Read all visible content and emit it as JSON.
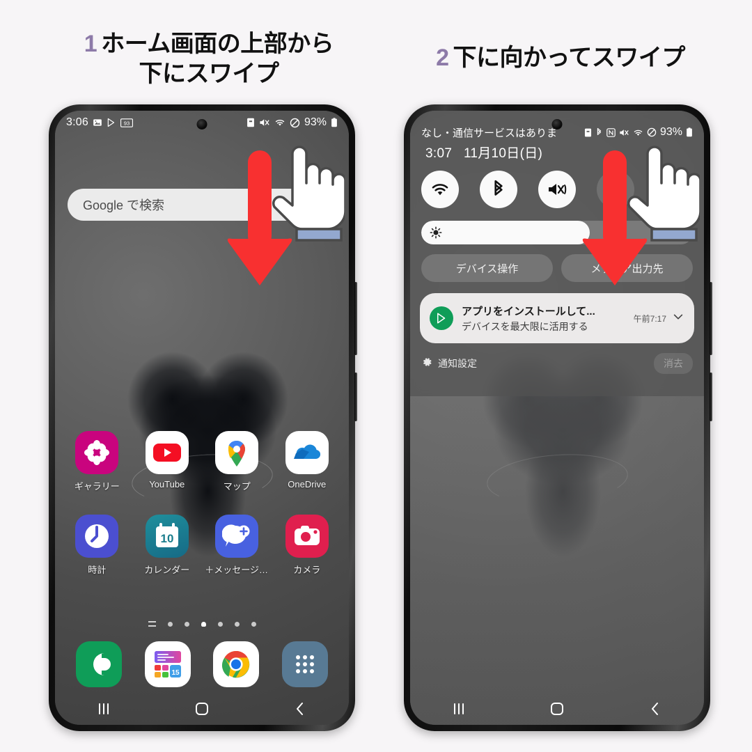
{
  "background_color": "#f7f5f7",
  "accent_number_color": "#8d7aa8",
  "arrow_color": "#f83030",
  "steps": [
    {
      "number": "1",
      "text_line1": "ホーム画面の上部から",
      "text_line2": "下にスワイプ"
    },
    {
      "number": "2",
      "text_line1": "下に向かってスワイプ",
      "text_line2": ""
    }
  ],
  "phone1": {
    "statusbar": {
      "time": "3:06",
      "icons_left": [
        "image-icon",
        "play-store-icon",
        "badge-93-icon"
      ],
      "badge_text": "93",
      "icons_right": [
        "sim-icon",
        "mute-icon",
        "wifi-icon",
        "dnd-icon"
      ],
      "battery_percent": "93%"
    },
    "search": {
      "placeholder": "Google で検索"
    },
    "apps_row1": [
      {
        "label": "ギャラリー",
        "icon": "gallery-icon"
      },
      {
        "label": "YouTube",
        "icon": "youtube-icon"
      },
      {
        "label": "マップ",
        "icon": "google-maps-icon"
      },
      {
        "label": "OneDrive",
        "icon": "onedrive-icon"
      }
    ],
    "apps_row2": [
      {
        "label": "時計",
        "icon": "clock-icon"
      },
      {
        "label": "カレンダー",
        "icon": "calendar-icon",
        "day": "10"
      },
      {
        "label": "＋メッセージ(...",
        "icon": "plus-message-icon"
      },
      {
        "label": "カメラ",
        "icon": "camera-icon"
      }
    ],
    "page_dots": {
      "count": 6,
      "active_index": 3,
      "has_leading_lines": true
    },
    "dock": [
      {
        "label": "",
        "icon": "phone-icon"
      },
      {
        "label": "",
        "icon": "widget-folder-icon",
        "day": "15"
      },
      {
        "label": "",
        "icon": "chrome-icon"
      },
      {
        "label": "",
        "icon": "app-drawer-icon"
      }
    ],
    "navbar": [
      "recents-icon",
      "home-icon",
      "back-icon"
    ]
  },
  "phone2": {
    "statusbar": {
      "carrier_text": "なし・通信サービスはありま",
      "icons_right": [
        "sim-icon",
        "bluetooth-icon",
        "nfc-icon",
        "mute-icon",
        "wifi-icon",
        "dnd-icon"
      ],
      "battery_percent": "93%"
    },
    "shade": {
      "time": "3:07",
      "date": "11月10日(日)",
      "quick_toggles": [
        {
          "icon": "wifi-icon",
          "state": "on"
        },
        {
          "icon": "bluetooth-icon",
          "state": "on"
        },
        {
          "icon": "sound-mute-vibrate-icon",
          "state": "on"
        },
        {
          "icon": "rotation-lock-icon",
          "state": "off"
        },
        {
          "icon": "flashlight-icon",
          "state": "off"
        }
      ],
      "brightness": {
        "icon": "brightness-icon",
        "level_percent": 62
      },
      "buttons": [
        {
          "label": "デバイス操作"
        },
        {
          "label": "メディア出力先"
        }
      ],
      "notification": {
        "app_icon": "play-store-icon",
        "title": "アプリをインストールして...",
        "text": "デバイスを最大限に活用する",
        "time": "午前7:17",
        "expand_icon": "chevron-down-icon"
      },
      "footer": {
        "settings_icon": "gear-icon",
        "settings_label": "通知設定",
        "clear_label": "消去"
      }
    },
    "navbar": [
      "recents-icon",
      "home-icon",
      "back-icon"
    ]
  },
  "cursor": {
    "icon": "pointing-hand-cursor"
  }
}
